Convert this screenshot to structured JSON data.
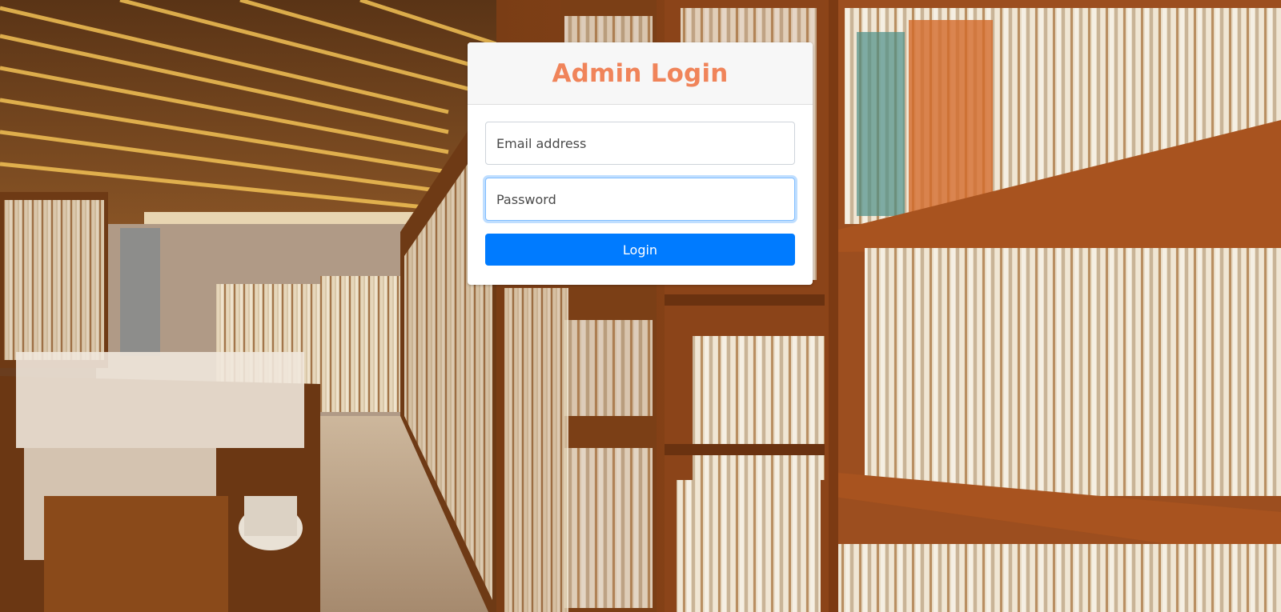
{
  "login": {
    "title": "Admin Login",
    "email_placeholder": "Email address",
    "password_placeholder": "Password",
    "button_label": "Login"
  },
  "colors": {
    "title": "#f0845a",
    "button": "#007bff",
    "focus_border": "#80bdff"
  }
}
